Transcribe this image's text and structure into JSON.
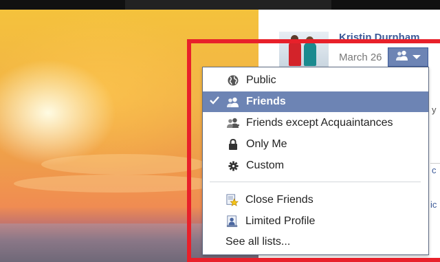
{
  "post": {
    "author_name": "Kristin Durnham",
    "date": "March 26",
    "fragment_y": "y",
    "fragment_c": "c",
    "fragment_ic": "ic"
  },
  "audience_menu": {
    "items": [
      {
        "label": "Public",
        "icon": "globe-icon",
        "selected": false
      },
      {
        "label": "Friends",
        "icon": "friends-icon",
        "selected": true
      },
      {
        "label": "Friends except Acquaintances",
        "icon": "friends-except-icon",
        "selected": false
      },
      {
        "label": "Only Me",
        "icon": "lock-icon",
        "selected": false
      },
      {
        "label": "Custom",
        "icon": "gear-icon",
        "selected": false
      }
    ],
    "lists": [
      {
        "label": "Close Friends",
        "icon": "star-list-icon"
      },
      {
        "label": "Limited Profile",
        "icon": "limited-profile-icon"
      }
    ],
    "see_all_label": "See all lists...",
    "check_mark": "✔"
  },
  "colors": {
    "selection_bg": "#6d84b4",
    "link_blue": "#3b5998",
    "highlight_red": "#e8202a"
  }
}
